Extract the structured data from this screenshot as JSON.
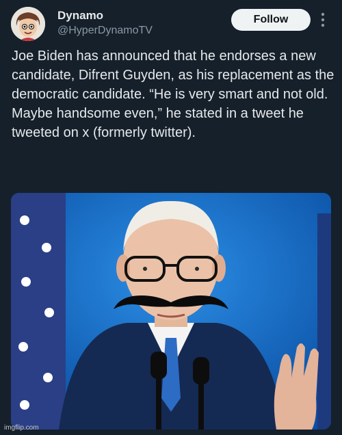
{
  "author": {
    "display_name": "Dynamo",
    "handle": "@HyperDynamoTV",
    "avatar_icon": "cartoon-avatar-icon"
  },
  "actions": {
    "follow_label": "Follow",
    "more_icon": "more-vertical-icon"
  },
  "tweet": {
    "text": "Joe Biden has announced that he endorses a new candidate, Difrent Guyden, as his replacement as the democratic candidate. “He is very smart and not old. Maybe handsome even,” he stated in a tweet he tweeted on x (formerly twitter)."
  },
  "media": {
    "type": "photo"
  },
  "watermark": {
    "text": "imgflip.com"
  },
  "colors": {
    "background": "#15202b",
    "follow_button_bg": "#eff3f4",
    "handle_gray": "#8b98a5",
    "photo_backdrop_blue": "#0b5fb8"
  }
}
